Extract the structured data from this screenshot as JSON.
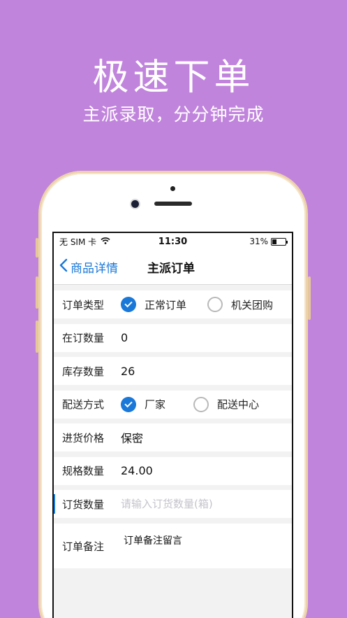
{
  "promo": {
    "title": "极速下单",
    "subtitle": "主派录取，分分钟完成"
  },
  "status_bar": {
    "carrier": "无 SIM 卡",
    "time": "11:30",
    "battery": "31%",
    "battery_level": 0.31
  },
  "nav": {
    "back_label": "商品详情",
    "title": "主派订单"
  },
  "form": {
    "order_type": {
      "label": "订单类型",
      "options": [
        {
          "label": "正常订单",
          "selected": true
        },
        {
          "label": "机关团购",
          "selected": false
        }
      ]
    },
    "on_order_qty": {
      "label": "在订数量",
      "value": "0"
    },
    "stock_qty": {
      "label": "库存数量",
      "value": "26"
    },
    "delivery": {
      "label": "配送方式",
      "options": [
        {
          "label": "厂家",
          "selected": true
        },
        {
          "label": "配送中心",
          "selected": false
        }
      ]
    },
    "purchase_price": {
      "label": "进货价格",
      "value": "保密"
    },
    "spec_qty": {
      "label": "规格数量",
      "value": "24.00"
    },
    "order_qty": {
      "label": "订货数量",
      "value": "",
      "placeholder": "请输入订货数量(箱)"
    },
    "remark": {
      "label": "订单备注",
      "value": "订单备注留言"
    }
  },
  "colors": {
    "background": "#c184dd",
    "accent": "#1a78d8"
  }
}
